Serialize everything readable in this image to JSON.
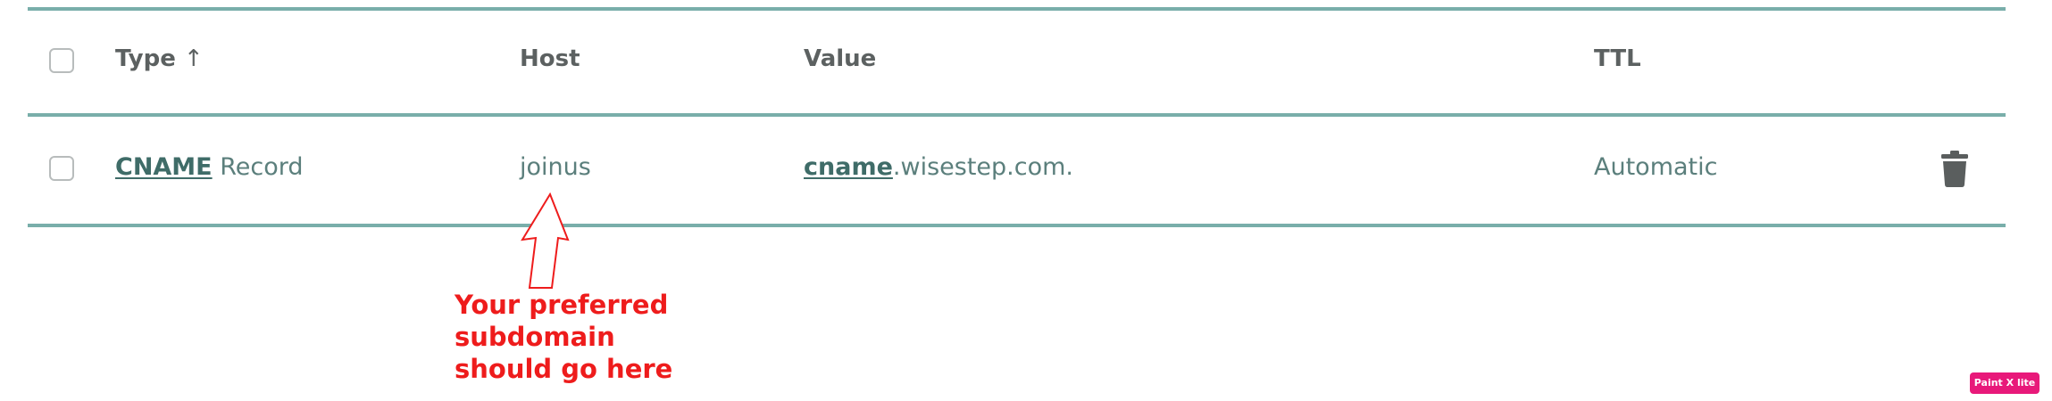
{
  "table": {
    "headers": {
      "type": "Type",
      "sort_indicator": "↑",
      "host": "Host",
      "value": "Value",
      "ttl": "TTL"
    },
    "rows": [
      {
        "type_link": "CNAME",
        "type_suffix": " Record",
        "host": "joinus",
        "value_link": "cname",
        "value_suffix": ".wisestep.com.",
        "ttl": "Automatic"
      }
    ]
  },
  "annotation": {
    "text": "Your preferred subdomain\nshould go here",
    "color": "#ee1c1c"
  },
  "watermark": {
    "label": "Paint X lite"
  },
  "colors": {
    "rule": "#79aeaa",
    "header_text": "#5c6161",
    "cell_text": "#5b7f7c",
    "link_text": "#3f6c68",
    "trash_icon": "#5a5e5e",
    "badge": "#e8197a"
  }
}
